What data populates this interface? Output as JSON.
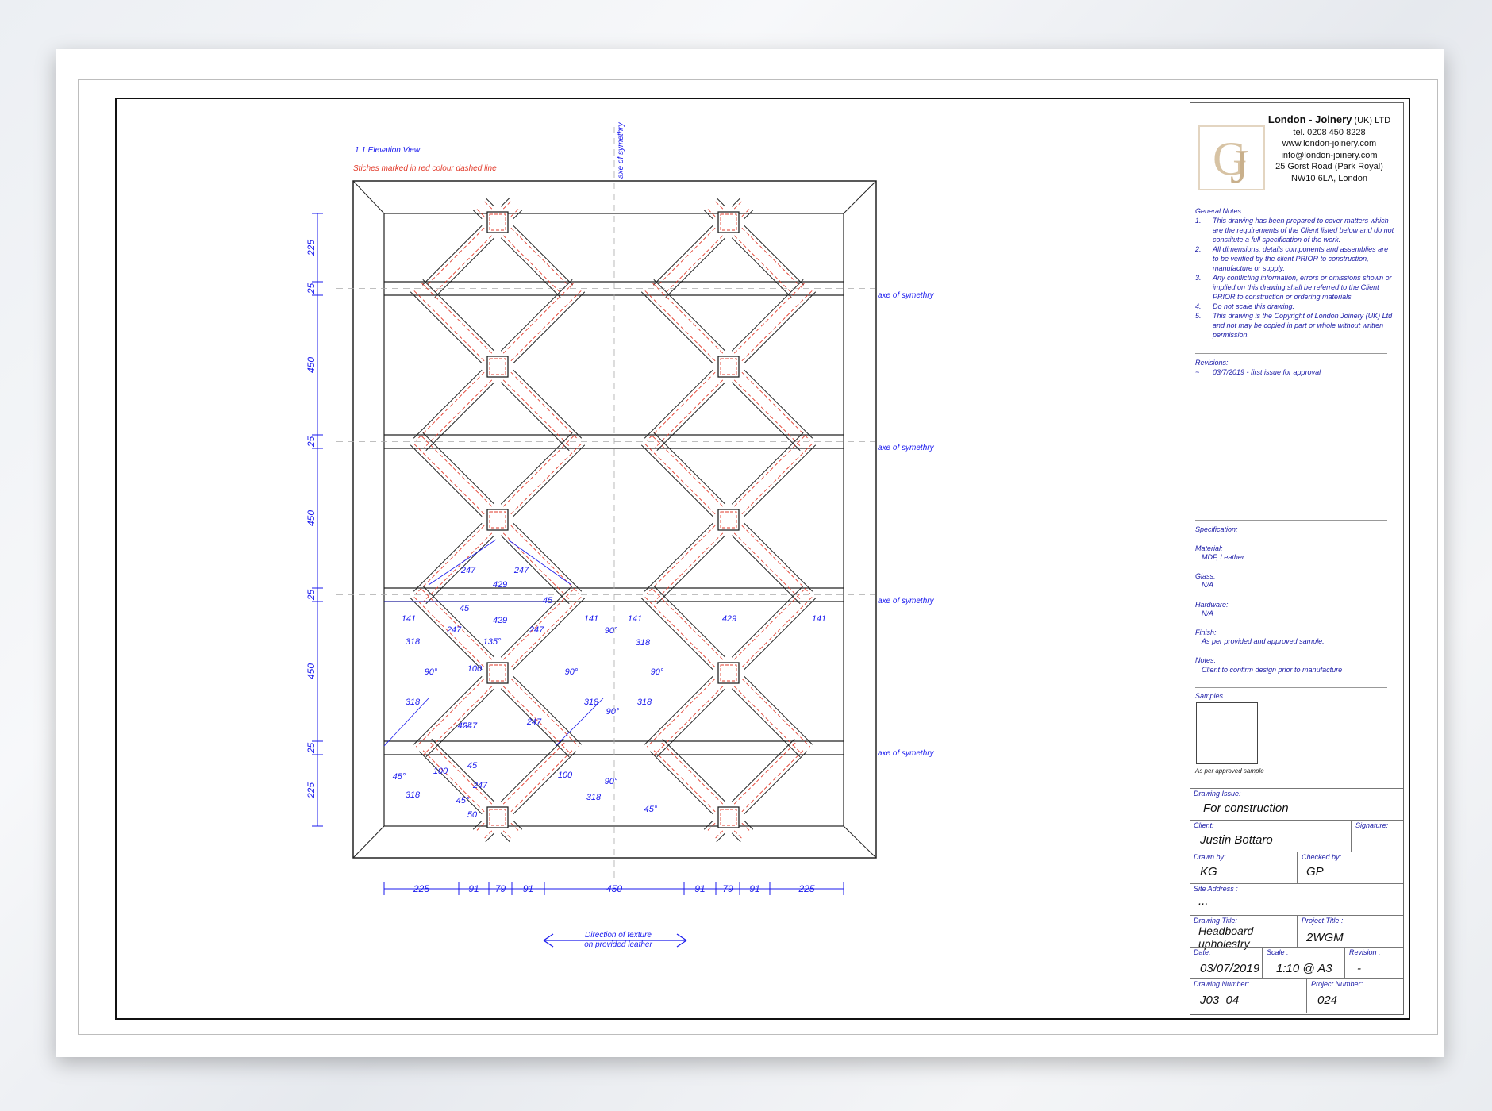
{
  "drawing": {
    "view_title": "1.1 Elevation View",
    "stitch_note": "Stiches marked in red colour dashed line",
    "axis_label": "axe of symethry",
    "texture_note_line1": "Direction of texture",
    "texture_note_line2": "on provided leather",
    "vertical_dims": [
      "225",
      "25",
      "450",
      "25",
      "450",
      "25",
      "450",
      "25",
      "225"
    ],
    "bottom_dims": [
      "225",
      "91",
      "79",
      "91",
      "450",
      "91",
      "79",
      "91",
      "225"
    ],
    "detail_dims": {
      "d247": "247",
      "d429": "429",
      "d141": "141",
      "d318": "318",
      "d100": "100",
      "d50": "50",
      "d45": "45",
      "a90": "90°",
      "a45": "45°",
      "a135": "135°"
    }
  },
  "company": {
    "name": "London - Joinery",
    "suffix": " (UK) LTD",
    "tel": "tel. 0208 450 8228",
    "web": "www.london-joinery.com",
    "email": "info@london-joinery.com",
    "address1": "25 Gorst Road (Park Royal)",
    "address2": "NW10 6LA, London",
    "logo_letters": "GJ"
  },
  "notes": {
    "heading": "General Notes:",
    "items": [
      {
        "n": "1.",
        "text": "This drawing has been prepared to cover matters which are the requirements of the Client listed below and do not constitute a full specification of the work."
      },
      {
        "n": "2.",
        "text": "All dimensions, details components and assemblies are to be verified by the client PRIOR to construction, manufacture or supply."
      },
      {
        "n": "3.",
        "text": "Any conflicting information, errors or omissions shown or implied on this drawing shall be referred to the Client PRIOR to construction or ordering materials."
      },
      {
        "n": "4.",
        "text": "Do not scale this drawing."
      },
      {
        "n": "5.",
        "text": "This drawing is the Copyright of London Joinery (UK) Ltd and not may be copied in part or whole without written permission."
      }
    ]
  },
  "revisions": {
    "heading": "Revisions:",
    "mark": "~",
    "entry": "03/7/2019 - first issue for approval"
  },
  "spec": {
    "heading": "Specification:",
    "material_label": "Material:",
    "material": "MDF, Leather",
    "glass_label": "Glass:",
    "glass": "N/A",
    "hardware_label": "Hardware:",
    "hardware": "N/A",
    "finish_label": "Finish:",
    "finish": "As per provided and approved sample.",
    "notes_label": "Notes:",
    "notes": "Client to confirm design prior to manufacture",
    "samples_label": "Samples",
    "samples_caption": "As per approved sample"
  },
  "fields": {
    "issue_label": "Drawing Issue:",
    "issue": "For construction",
    "client_label": "Client:",
    "client": "Justin Bottaro",
    "signature_label": "Signature:",
    "drawn_label": "Drawn by:",
    "drawn": "KG",
    "checked_label": "Checked  by:",
    "checked": "GP",
    "site_label": "Site Address :",
    "site": "...",
    "title_label": "Drawing Title:",
    "title1": "Headboard",
    "title2": "upholestry",
    "project_label": "Project Title :",
    "project": "2WGM",
    "date_label": "Date:",
    "date": "03/07/2019",
    "scale_label": "Scale :",
    "scale": "1:10 @ A3",
    "revision_label": "Revision :",
    "revision": "-",
    "number_label": "Drawing Number:",
    "number": "J03_04",
    "project_number_label": "Project Number:",
    "project_number": "024"
  },
  "colors": {
    "dimension": "#1a1aee",
    "stitch": "#e23a2a",
    "line": "#222222"
  }
}
